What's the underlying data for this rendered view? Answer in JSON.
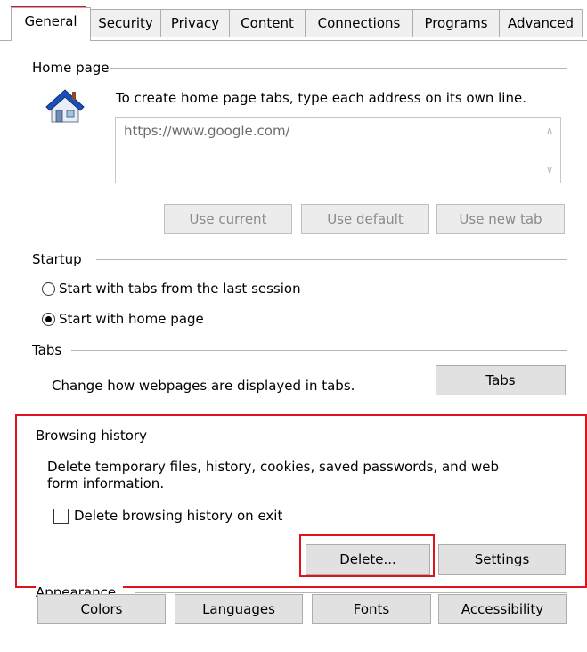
{
  "tabs": [
    {
      "label": "General"
    },
    {
      "label": "Security"
    },
    {
      "label": "Privacy"
    },
    {
      "label": "Content"
    },
    {
      "label": "Connections"
    },
    {
      "label": "Programs"
    },
    {
      "label": "Advanced"
    }
  ],
  "home_page": {
    "title": "Home page",
    "instructions": "To create home page tabs, type each address on its own line.",
    "url_value": "https://www.google.com/",
    "use_current": "Use current",
    "use_default": "Use default",
    "use_new_tab": "Use new tab"
  },
  "startup": {
    "title": "Startup",
    "option_last_session": "Start with tabs from the last session",
    "option_home_page": "Start with home page",
    "selected": "home_page"
  },
  "tabs_group": {
    "title": "Tabs",
    "description": "Change how webpages are displayed in tabs.",
    "button": "Tabs"
  },
  "browsing_history": {
    "title": "Browsing history",
    "description_line1": "Delete temporary files, history, cookies, saved passwords, and web",
    "description_line2": "form information.",
    "checkbox_label": "Delete browsing history on exit",
    "checked": false,
    "delete_button": "Delete...",
    "settings_button": "Settings"
  },
  "appearance": {
    "title": "Appearance",
    "colors": "Colors",
    "languages": "Languages",
    "fonts": "Fonts",
    "accessibility": "Accessibility"
  },
  "colors": {
    "highlight": "#e0121b",
    "house_roof": "#1b4fb5",
    "house_wall": "#e8eef5"
  }
}
